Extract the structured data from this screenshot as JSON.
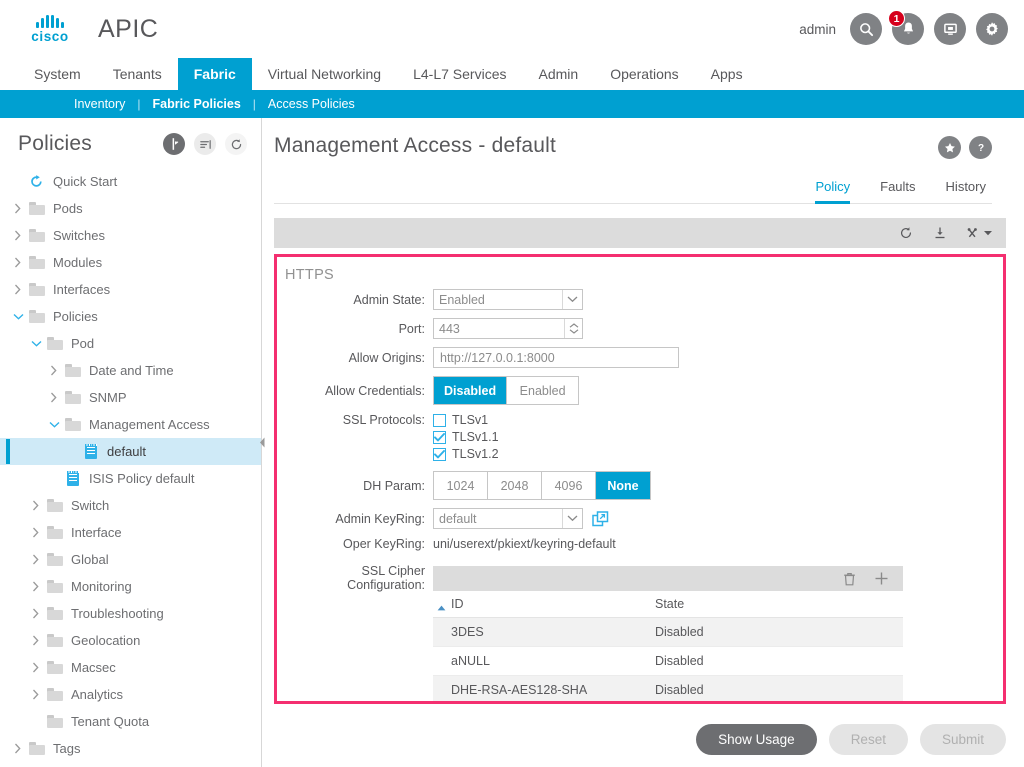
{
  "header": {
    "brand": "cisco",
    "product": "APIC",
    "user": "admin",
    "icons": [
      {
        "name": "search-icon"
      },
      {
        "name": "alerts-bell-icon",
        "badge": "1"
      },
      {
        "name": "remote-screen-icon"
      },
      {
        "name": "settings-gear-icon"
      }
    ]
  },
  "mainnav": {
    "items": [
      {
        "label": "System",
        "active": false
      },
      {
        "label": "Tenants",
        "active": false
      },
      {
        "label": "Fabric",
        "active": true
      },
      {
        "label": "Virtual Networking",
        "active": false
      },
      {
        "label": "L4-L7 Services",
        "active": false
      },
      {
        "label": "Admin",
        "active": false
      },
      {
        "label": "Operations",
        "active": false
      },
      {
        "label": "Apps",
        "active": false
      }
    ]
  },
  "subnav": {
    "items": [
      {
        "label": "Inventory",
        "active": false
      },
      {
        "label": "Fabric Policies",
        "active": true
      },
      {
        "label": "Access Policies",
        "active": false
      }
    ],
    "separator": "|"
  },
  "sidebar": {
    "title": "Policies",
    "header_icons": [
      "collapse-panel-icon",
      "align-list-icon",
      "refresh-icon"
    ],
    "tree": [
      {
        "label": "Quick Start",
        "indent": 1,
        "icon": "quickstart-icon",
        "twisty": "none"
      },
      {
        "label": "Pods",
        "indent": 1,
        "icon": "folder-icon",
        "twisty": "collapsed"
      },
      {
        "label": "Switches",
        "indent": 1,
        "icon": "folder-icon",
        "twisty": "collapsed"
      },
      {
        "label": "Modules",
        "indent": 1,
        "icon": "folder-icon",
        "twisty": "collapsed"
      },
      {
        "label": "Interfaces",
        "indent": 1,
        "icon": "folder-icon",
        "twisty": "collapsed"
      },
      {
        "label": "Policies",
        "indent": 1,
        "icon": "folder-icon",
        "twisty": "expanded"
      },
      {
        "label": "Pod",
        "indent": 2,
        "icon": "folder-icon",
        "twisty": "expanded"
      },
      {
        "label": "Date and Time",
        "indent": 3,
        "icon": "folder-icon",
        "twisty": "collapsed"
      },
      {
        "label": "SNMP",
        "indent": 3,
        "icon": "folder-icon",
        "twisty": "collapsed"
      },
      {
        "label": "Management Access",
        "indent": 3,
        "icon": "folder-icon",
        "twisty": "expanded"
      },
      {
        "label": "default",
        "indent": 4,
        "icon": "policy-doc-icon",
        "twisty": "none",
        "selected": true
      },
      {
        "label": "ISIS Policy default",
        "indent": 3,
        "icon": "policy-doc-icon",
        "twisty": "none"
      },
      {
        "label": "Switch",
        "indent": 2,
        "icon": "folder-icon",
        "twisty": "collapsed"
      },
      {
        "label": "Interface",
        "indent": 2,
        "icon": "folder-icon",
        "twisty": "collapsed"
      },
      {
        "label": "Global",
        "indent": 2,
        "icon": "folder-icon",
        "twisty": "collapsed"
      },
      {
        "label": "Monitoring",
        "indent": 2,
        "icon": "folder-icon",
        "twisty": "collapsed"
      },
      {
        "label": "Troubleshooting",
        "indent": 2,
        "icon": "folder-icon",
        "twisty": "collapsed"
      },
      {
        "label": "Geolocation",
        "indent": 2,
        "icon": "folder-icon",
        "twisty": "collapsed"
      },
      {
        "label": "Macsec",
        "indent": 2,
        "icon": "folder-icon",
        "twisty": "collapsed"
      },
      {
        "label": "Analytics",
        "indent": 2,
        "icon": "folder-icon",
        "twisty": "collapsed"
      },
      {
        "label": "Tenant Quota",
        "indent": 2,
        "icon": "folder-icon",
        "twisty": "none"
      },
      {
        "label": "Tags",
        "indent": 1,
        "icon": "folder-icon",
        "twisty": "collapsed"
      }
    ]
  },
  "main": {
    "page_title": "Management Access - default",
    "head_icons": [
      "favorite-star-icon",
      "help-question-icon"
    ],
    "tabs": [
      {
        "label": "Policy",
        "active": true
      },
      {
        "label": "Faults",
        "active": false
      },
      {
        "label": "History",
        "active": false
      }
    ],
    "toolbar_icons": [
      "refresh-icon",
      "download-icon",
      "actions-tools-icon"
    ]
  },
  "form": {
    "section_title": "HTTPS",
    "admin_state": {
      "label": "Admin State:",
      "value": "Enabled"
    },
    "port": {
      "label": "Port:",
      "value": "443"
    },
    "allow_origins": {
      "label": "Allow Origins:",
      "value": "http://127.0.0.1:8000"
    },
    "allow_credentials": {
      "label": "Allow Credentials:",
      "options": [
        {
          "label": "Disabled",
          "active": true
        },
        {
          "label": "Enabled",
          "active": false
        }
      ]
    },
    "ssl_protocols": {
      "label": "SSL Protocols:",
      "options": [
        {
          "label": "TLSv1",
          "checked": false
        },
        {
          "label": "TLSv1.1",
          "checked": true
        },
        {
          "label": "TLSv1.2",
          "checked": true
        }
      ]
    },
    "dh_param": {
      "label": "DH Param:",
      "options": [
        {
          "label": "1024",
          "active": false
        },
        {
          "label": "2048",
          "active": false
        },
        {
          "label": "4096",
          "active": false
        },
        {
          "label": "None",
          "active": true
        }
      ]
    },
    "admin_keyring": {
      "label": "Admin KeyRing:",
      "value": "default"
    },
    "oper_keyring": {
      "label": "Oper KeyRing:",
      "value": "uni/userext/pkiext/keyring-default"
    },
    "ssl_cipher": {
      "label": "SSL Cipher Configuration:",
      "bar_icons": [
        "delete-trash-icon",
        "add-plus-icon"
      ],
      "columns": [
        "ID",
        "State"
      ],
      "rows": [
        {
          "id": "3DES",
          "state": "Disabled"
        },
        {
          "id": "aNULL",
          "state": "Disabled"
        },
        {
          "id": "DHE-RSA-AES128-SHA",
          "state": "Disabled"
        }
      ]
    }
  },
  "footer": {
    "buttons": [
      {
        "label": "Show Usage",
        "style": "primary"
      },
      {
        "label": "Reset",
        "style": "disabled"
      },
      {
        "label": "Submit",
        "style": "disabled"
      }
    ]
  },
  "colors": {
    "brand_blue": "#00a0d1",
    "highlight_pink": "#f42f70",
    "badge_red": "#d6001c"
  }
}
